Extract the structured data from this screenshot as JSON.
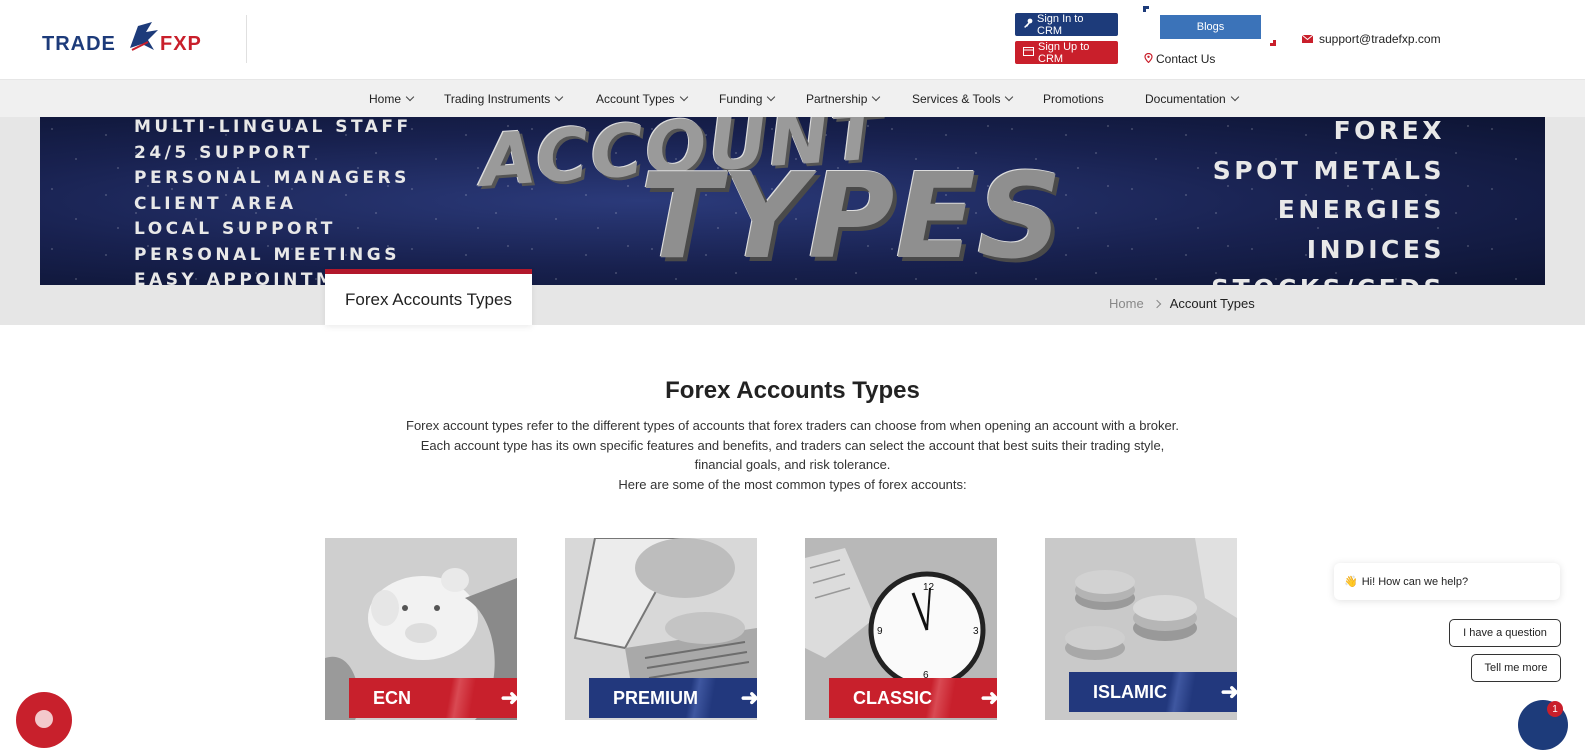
{
  "brand": {
    "logo_text_left": "TRADE",
    "logo_text_right": "FXP",
    "colors": {
      "navy": "#1d3b7a",
      "red": "#c91f2b",
      "blue": "#3b73b9"
    }
  },
  "header": {
    "sign_in": "Sign In to CRM",
    "sign_up": "Sign Up to CRM",
    "blogs": "Blogs",
    "contact": "Contact Us",
    "email": "support@tradefxp.com"
  },
  "nav": {
    "items": [
      {
        "label": "Home",
        "dropdown": true
      },
      {
        "label": "Trading Instruments",
        "dropdown": true
      },
      {
        "label": "Account Types",
        "dropdown": true
      },
      {
        "label": "Funding",
        "dropdown": true
      },
      {
        "label": "Partnership",
        "dropdown": true
      },
      {
        "label": "Services & Tools",
        "dropdown": true
      },
      {
        "label": "Promotions",
        "dropdown": false
      },
      {
        "label": "Documentation",
        "dropdown": true
      }
    ]
  },
  "banner": {
    "left_lines": [
      "MULTI-LINGUAL STAFF",
      "24/5 SUPPORT",
      "PERSONAL MANAGERS",
      "CLIENT AREA",
      "LOCAL SUPPORT",
      "PERSONAL MEETINGS",
      "EASY APPOINTMENTS"
    ],
    "title_top": "ACCOUNT",
    "title_bottom": "TYPES",
    "right_lines": [
      "FOREX",
      "SPOT METALS",
      "ENERGIES",
      "INDICES",
      "STOCKS/CFDS"
    ]
  },
  "page_tab": "Forex Accounts Types",
  "breadcrumb": {
    "home": "Home",
    "current": "Account Types"
  },
  "main": {
    "title": "Forex Accounts Types",
    "intro_1": "Forex account types refer to the different types of accounts that forex traders can choose from when opening an account with a broker. Each account type has its own specific features and benefits, and traders can select the account that best suits their trading style, financial goals, and risk tolerance.",
    "intro_2": "Here are some of the most common types of forex accounts:"
  },
  "cards": [
    {
      "label": "ECN",
      "color": "red"
    },
    {
      "label": "PREMIUM",
      "color": "blue"
    },
    {
      "label": "CLASSIC",
      "color": "red"
    },
    {
      "label": "ISLAMIC",
      "color": "blue"
    }
  ],
  "chat": {
    "greeting": "Hi! How can we help?",
    "greeting_icon": "waving-hand-icon",
    "option_1": "I have a question",
    "option_2": "Tell me more",
    "badge_count": "1"
  }
}
